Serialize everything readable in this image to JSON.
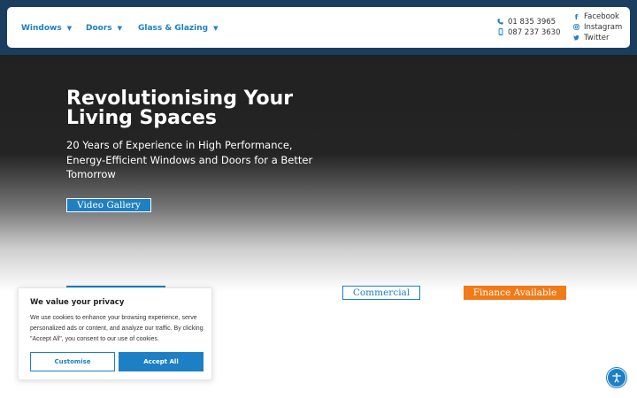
{
  "nav": {
    "items": [
      {
        "label": "Windows",
        "icon": "chevron-down-icon"
      },
      {
        "label": "Doors",
        "icon": "chevron-down-icon"
      },
      {
        "label": "Glass & Glazing",
        "icon": "chevron-down-icon"
      }
    ],
    "phones": [
      {
        "label": "01 835 3965",
        "icon": "phone-icon"
      },
      {
        "label": "087 237 3630",
        "icon": "mobile-phone-icon"
      }
    ],
    "socials": [
      {
        "label": "Facebook",
        "icon": "facebook-icon"
      },
      {
        "label": "Instagram",
        "icon": "instagram-icon"
      },
      {
        "label": "Twitter",
        "icon": "twitter-icon"
      }
    ]
  },
  "hero": {
    "title": "Revolutionising Your Living Spaces",
    "subtitle": "20 Years of Experience in High Performance, Energy-Efficient Windows and Doors for a Better Tomorrow",
    "video_button": "Video Gallery"
  },
  "buttons": {
    "commercial": "Commercial",
    "finance": "Finance Available"
  },
  "cookie": {
    "title": "We value your privacy",
    "text": "We use cookies to enhance your browsing experience, serve personalized ads or content, and analyze our traffic. By clicking \"Accept All\", you consent to our use of cookies.",
    "customise_label": "Customise",
    "accept_label": "Accept All"
  },
  "accessibility": {
    "icon": "accessibility-icon"
  },
  "colors": {
    "brand_blue": "#1d7fc4",
    "header_navy": "#1b3e5f",
    "accent_orange": "#f07b18",
    "hero_dark": "#212121"
  }
}
